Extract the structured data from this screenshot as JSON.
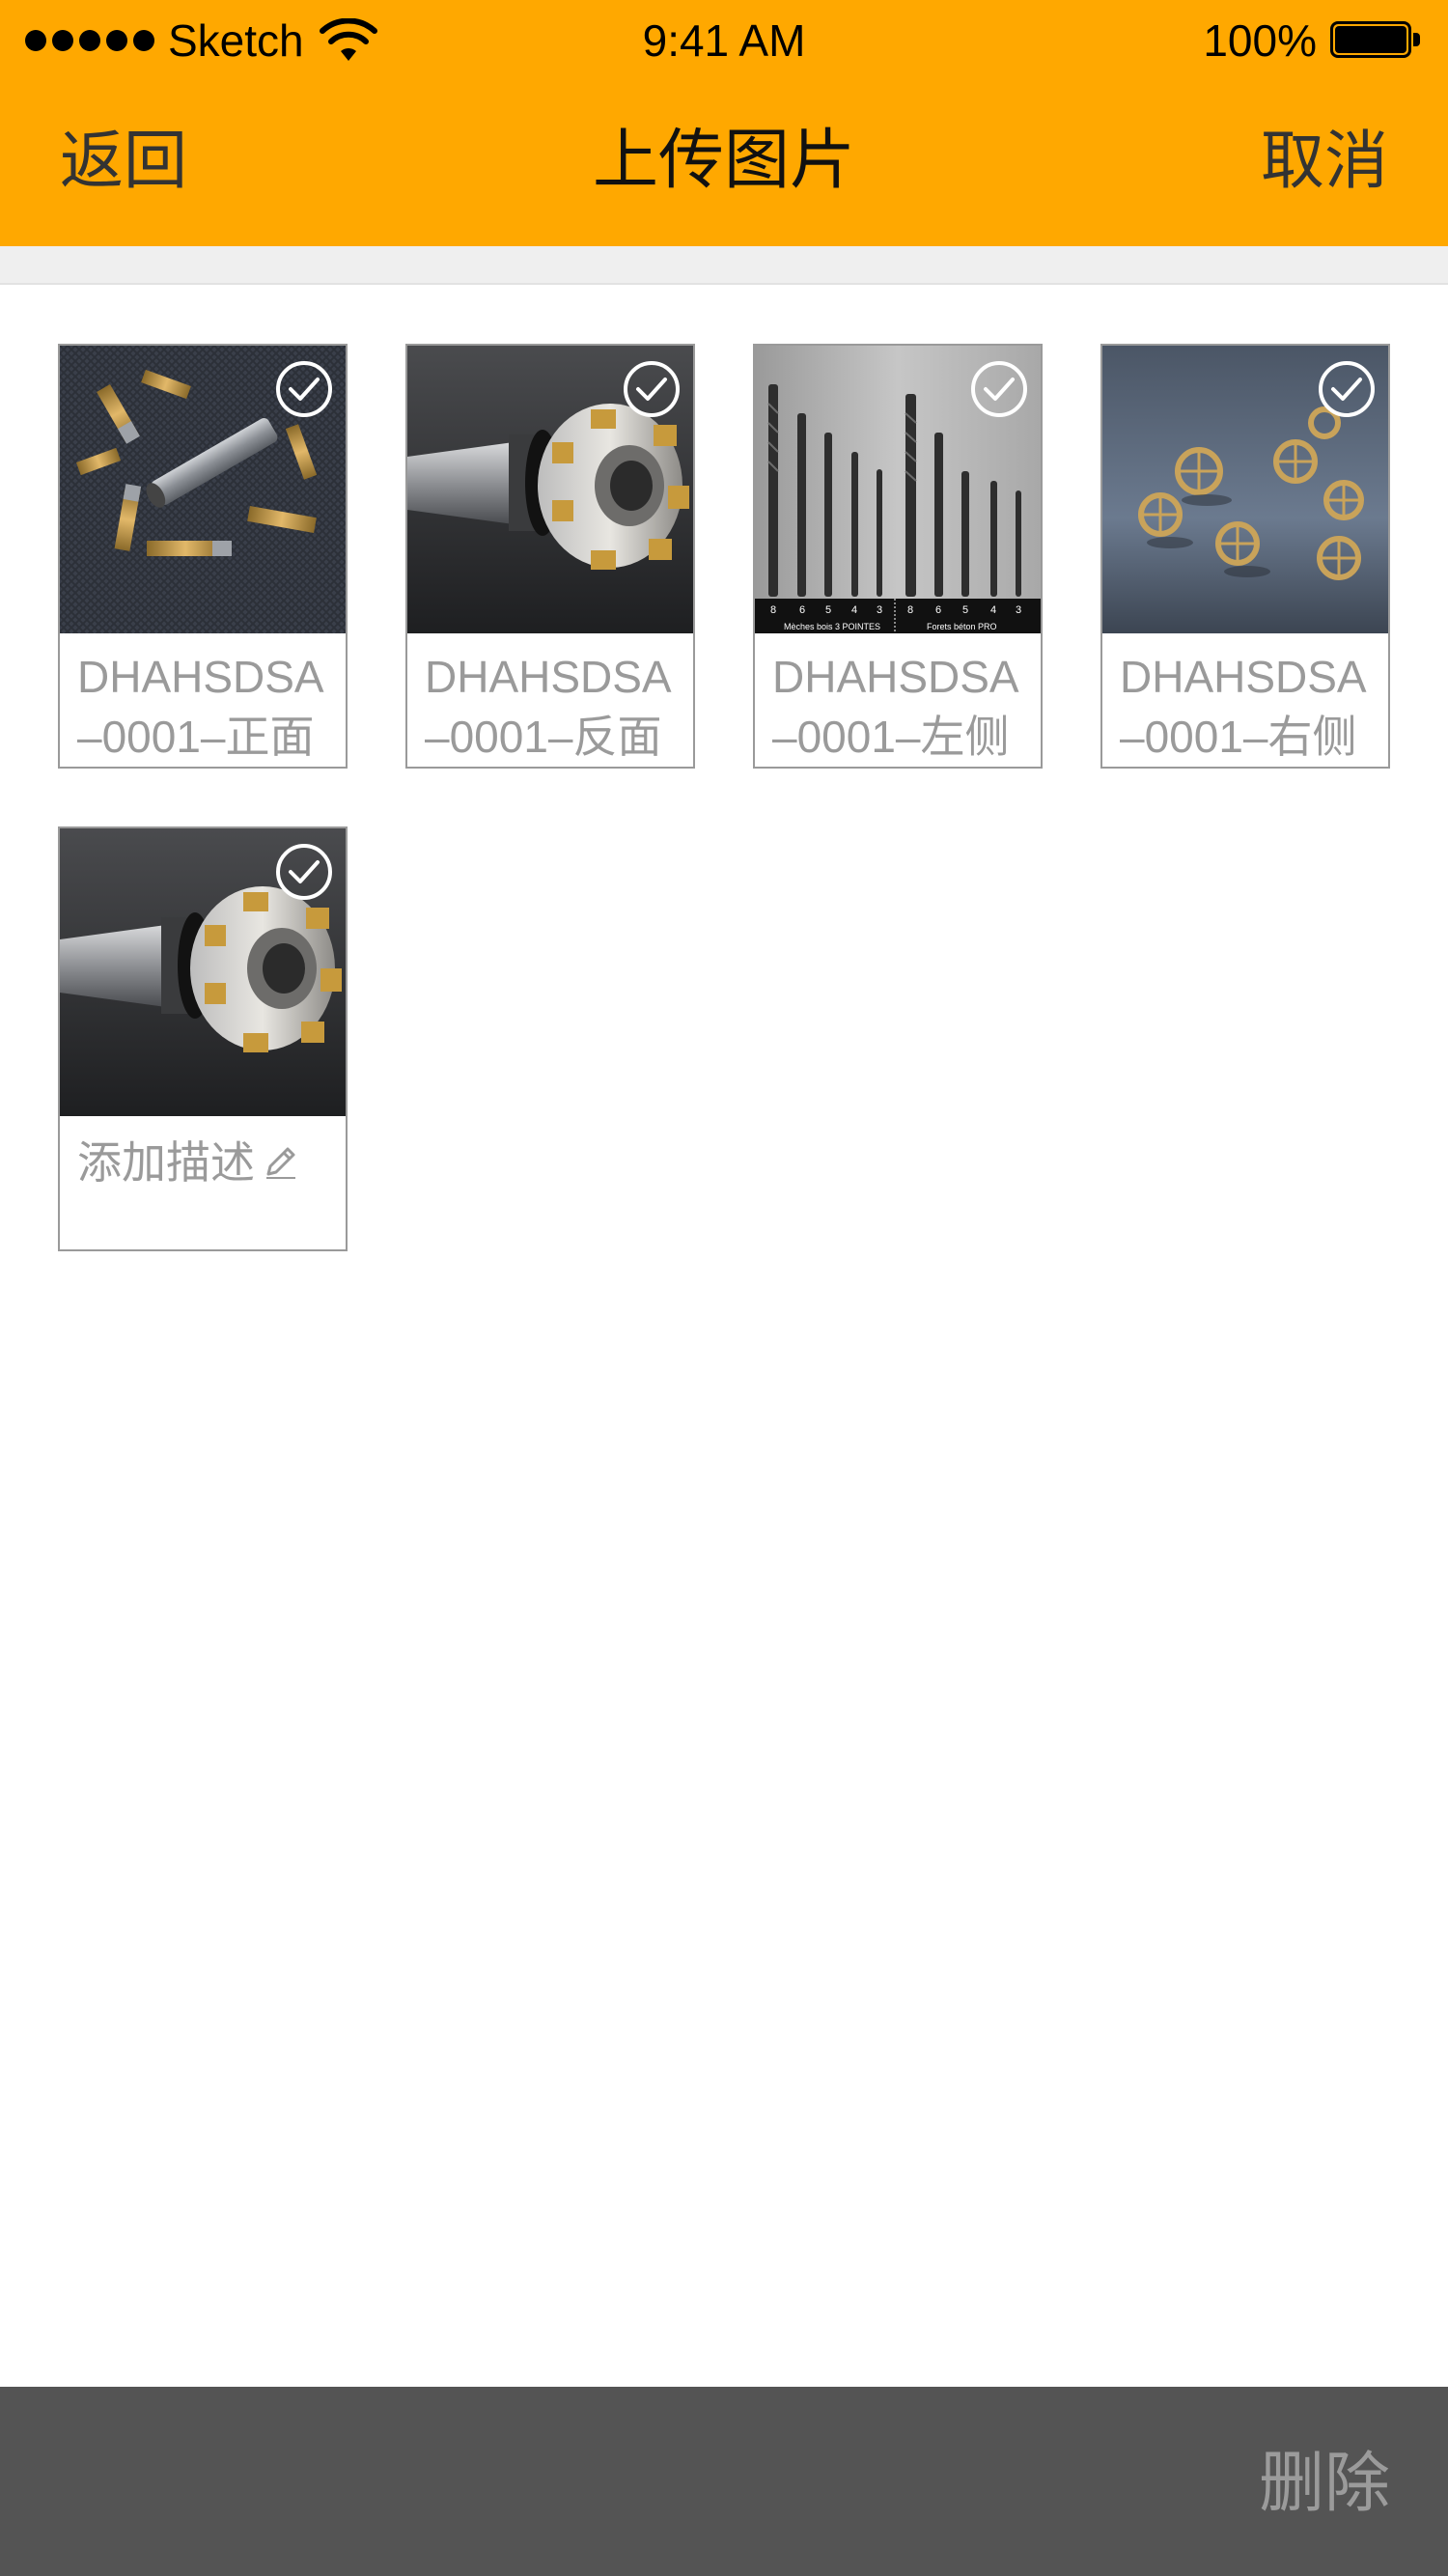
{
  "status_bar": {
    "carrier": "Sketch",
    "time": "9:41 AM",
    "battery": "100%"
  },
  "nav": {
    "back_label": "返回",
    "title": "上传图片",
    "cancel_label": "取消"
  },
  "images": [
    {
      "line1": "DHAHSDSA",
      "line2": "–0001–正面",
      "selected": true,
      "subject": "torx-bits"
    },
    {
      "line1": "DHAHSDSA",
      "line2": "–0001–反面",
      "selected": true,
      "subject": "milling-cutter"
    },
    {
      "line1": "DHAHSDSA",
      "line2": "–0001–左侧",
      "selected": true,
      "subject": "drill-bits"
    },
    {
      "line1": "DHAHSDSA",
      "line2": "–0001–右侧",
      "selected": true,
      "subject": "watch-gears"
    },
    {
      "add_description": "添加描述",
      "selected": true,
      "subject": "milling-cutter"
    }
  ],
  "drill_labels": {
    "left_caption": "Mèches bois 3 POINTES",
    "right_caption": "Forets béton PRO",
    "sizes": [
      "8",
      "6",
      "5",
      "4",
      "3",
      "8",
      "6",
      "5",
      "4",
      "3"
    ]
  },
  "bottom_bar": {
    "delete_label": "删除"
  },
  "colors": {
    "header": "#FFA800",
    "bottom_bar": "#545454",
    "caption_text": "#9a9a9a"
  }
}
